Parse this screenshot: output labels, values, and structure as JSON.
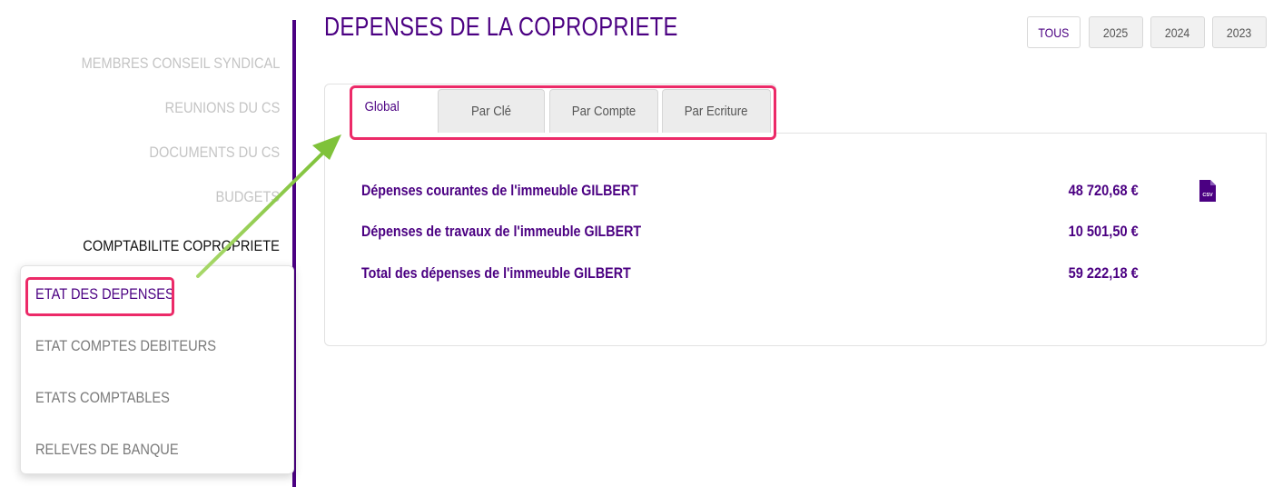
{
  "sidebar": {
    "items": [
      {
        "label": "MEMBRES CONSEIL SYNDICAL"
      },
      {
        "label": "REUNIONS DU CS"
      },
      {
        "label": "DOCUMENTS DU CS"
      },
      {
        "label": "BUDGETS"
      },
      {
        "label": "COMPTABILITE COPROPRIETE"
      }
    ],
    "submenu": [
      {
        "label": "ETAT DES DEPENSES"
      },
      {
        "label": "ETAT COMPTES DEBITEURS"
      },
      {
        "label": "ETATS COMPTABLES"
      },
      {
        "label": "RELEVES DE BANQUE"
      }
    ]
  },
  "main": {
    "title": "DEPENSES DE LA COPROPRIETE",
    "year_filters": [
      "TOUS",
      "2025",
      "2024",
      "2023"
    ],
    "selected_filter": "TOUS",
    "tabs": [
      "Global",
      "Par Clé",
      "Par Compte",
      "Par Ecriture"
    ],
    "active_tab": "Global",
    "rows": [
      {
        "label": "Dépenses courantes de l'immeuble GILBERT",
        "value": "48 720,68 €"
      },
      {
        "label": "Dépenses de travaux de l'immeuble GILBERT",
        "value": "10 501,50 €"
      },
      {
        "label": "Total des dépenses de l'immeuble GILBERT",
        "value": "59 222,18 €"
      }
    ],
    "export_icon": "csv-file-icon",
    "export_icon_text": "CSV"
  },
  "colors": {
    "accent": "#4b0082",
    "highlight": "#ec2a68",
    "arrow": "#8cc63f",
    "muted": "#c4c4c4"
  }
}
